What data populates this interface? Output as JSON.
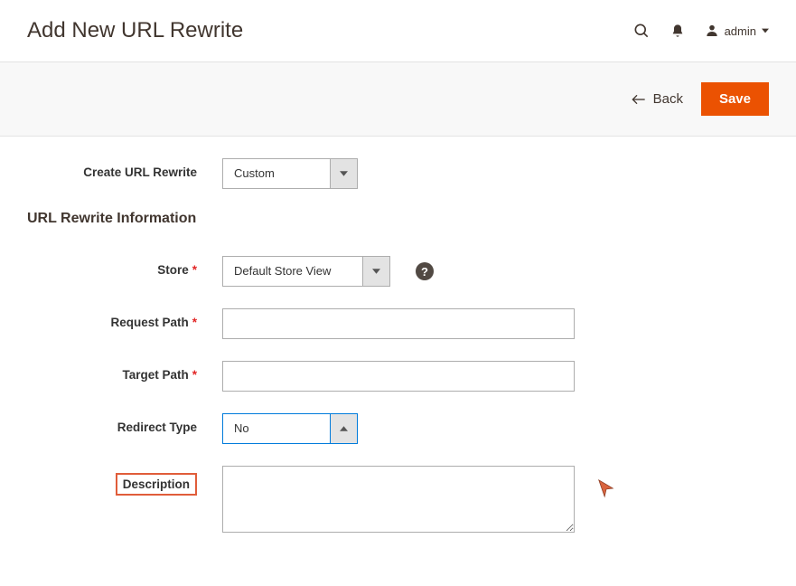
{
  "header": {
    "title": "Add New URL Rewrite",
    "admin_label": "admin"
  },
  "toolbar": {
    "back_label": "Back",
    "save_label": "Save"
  },
  "form": {
    "create_rewrite": {
      "label": "Create URL Rewrite",
      "value": "Custom"
    },
    "section_title": "URL Rewrite Information",
    "store": {
      "label": "Store",
      "value": "Default Store View"
    },
    "request_path": {
      "label": "Request Path",
      "value": ""
    },
    "target_path": {
      "label": "Target Path",
      "value": ""
    },
    "redirect_type": {
      "label": "Redirect Type",
      "value": "No"
    },
    "description": {
      "label": "Description",
      "value": ""
    }
  }
}
